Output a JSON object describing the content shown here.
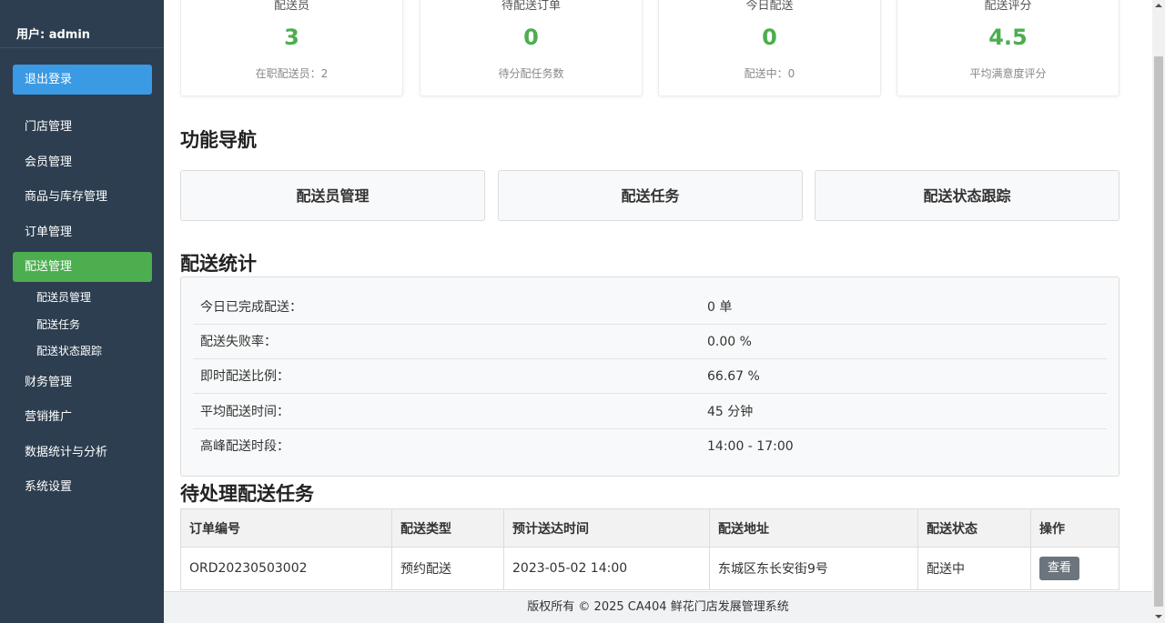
{
  "sidebar": {
    "user": "用户: admin",
    "logout": "退出登录",
    "nav": [
      {
        "label": "门店管理"
      },
      {
        "label": "会员管理"
      },
      {
        "label": "商品与库存管理"
      },
      {
        "label": "订单管理"
      },
      {
        "label": "配送管理",
        "active": true
      },
      {
        "label": "财务管理"
      },
      {
        "label": "营销推广"
      },
      {
        "label": "数据统计与分析"
      },
      {
        "label": "系统设置"
      }
    ],
    "sub": [
      "配送员管理",
      "配送任务",
      "配送状态跟踪"
    ]
  },
  "stats": [
    {
      "label": "配送员",
      "value": "3",
      "sub": "在职配送员：2"
    },
    {
      "label": "待配送订单",
      "value": "0",
      "sub": "待分配任务数"
    },
    {
      "label": "今日配送",
      "value": "0",
      "sub": "配送中：0"
    },
    {
      "label": "配送评分",
      "value": "4.5",
      "sub": "平均满意度评分"
    }
  ],
  "sections": {
    "nav_title": "功能导航",
    "stats_title": "配送统计",
    "tasks_title": "待处理配送任务"
  },
  "functions": [
    "配送员管理",
    "配送任务",
    "配送状态跟踪"
  ],
  "delivery_stats": [
    {
      "label": "今日已完成配送：",
      "value": "0 单"
    },
    {
      "label": "配送失败率：",
      "value": "0.00 %"
    },
    {
      "label": "即时配送比例：",
      "value": "66.67 %"
    },
    {
      "label": "平均配送时间：",
      "value": "45 分钟"
    },
    {
      "label": "高峰配送时段：",
      "value": "14:00 - 17:00"
    }
  ],
  "table": {
    "headers": [
      "订单编号",
      "配送类型",
      "预计送达时间",
      "配送地址",
      "配送状态",
      "操作"
    ],
    "rows": [
      [
        "ORD20230503002",
        "预约配送",
        "2023-05-02 14:00",
        "东城区东长安街9号",
        "配送中",
        "查看"
      ]
    ]
  },
  "footer": "版权所有 © 2025 CA404 鲜花门店发展管理系统",
  "colors": {
    "sidebar": "#2c3e50",
    "logout": "#3a9ae3",
    "active": "#4cae4f",
    "accent_value": "#4cae4f"
  }
}
